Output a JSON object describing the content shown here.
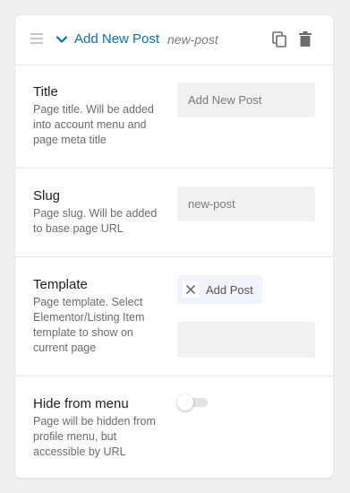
{
  "header": {
    "title": "Add New Post",
    "slug": "new-post"
  },
  "fields": {
    "title": {
      "label": "Title",
      "description": "Page title. Will be added into account menu and page meta title",
      "value": "",
      "placeholder": "Add New Post"
    },
    "slug": {
      "label": "Slug",
      "description": "Page slug. Will be added to base page URL",
      "value": "",
      "placeholder": "new-post"
    },
    "template": {
      "label": "Template",
      "description": "Page template. Select Elementor/Listing Item template to show on current page",
      "selected": "Add Post",
      "search_value": ""
    },
    "hide_from_menu": {
      "label": "Hide from menu",
      "description": "Page will be hidden from profile menu, but accessible by URL",
      "enabled": false
    }
  },
  "icons": {
    "drag": "drag-handle-icon",
    "chevron": "chevron-down-icon",
    "copy": "copy-icon",
    "delete": "trash-icon",
    "remove": "close-icon"
  },
  "colors": {
    "accent": "#0b72b8",
    "background": "#f0f0f1",
    "input_bg": "#f1f1f1",
    "chip_bg": "#eef4fa"
  }
}
